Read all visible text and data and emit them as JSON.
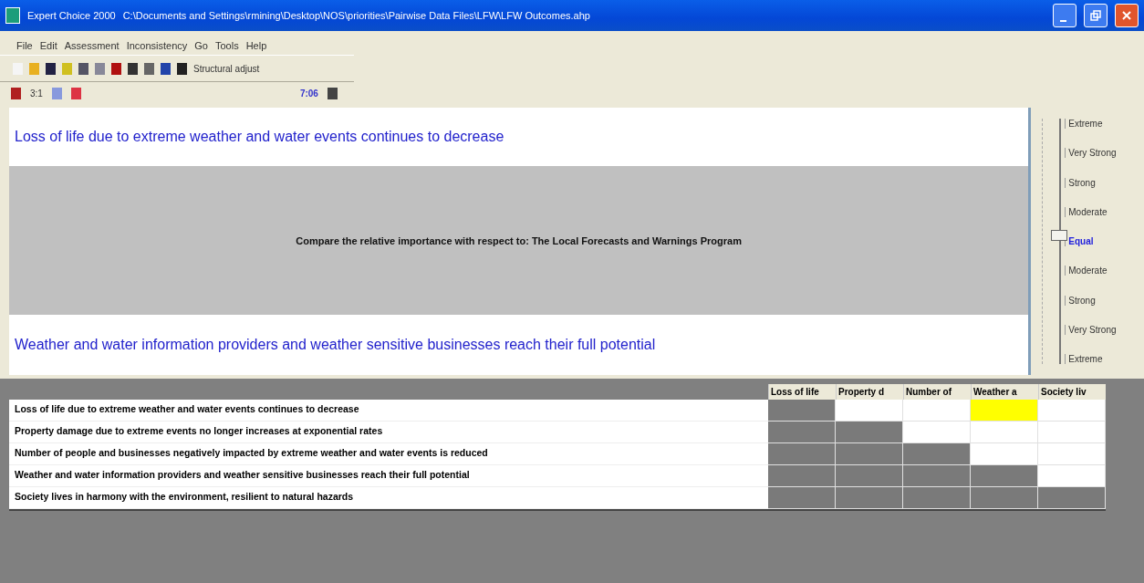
{
  "window": {
    "app": "Expert Choice 2000",
    "path": "C:\\Documents and Settings\\rmining\\Desktop\\NOS\\priorities\\Pairwise Data Files\\LFW\\LFW Outcomes.ahp"
  },
  "menu": [
    "File",
    "Edit",
    "Assessment",
    "Inconsistency",
    "Go",
    "Tools",
    "Help"
  ],
  "toolbar": {
    "structural_label": "Structural adjust",
    "ratio": "3:1",
    "counter": "7:06"
  },
  "comparison": {
    "top": "Loss of life due to extreme weather and water events continues to decrease",
    "prompt": "Compare the relative importance  with respect to: The Local Forecasts and Warnings Program",
    "bottom": "Weather and water information providers and weather sensitive businesses reach their full potential"
  },
  "scale": [
    {
      "label": "Extreme",
      "selected": false
    },
    {
      "label": "Very Strong",
      "selected": false
    },
    {
      "label": "Strong",
      "selected": false
    },
    {
      "label": "Moderate",
      "selected": false
    },
    {
      "label": "Equal",
      "selected": true
    },
    {
      "label": "Moderate",
      "selected": false
    },
    {
      "label": "Strong",
      "selected": false
    },
    {
      "label": "Very Strong",
      "selected": false
    },
    {
      "label": "Extreme",
      "selected": false
    }
  ],
  "matrix": {
    "columns": [
      "Loss of life",
      "Property d",
      "Number of",
      "Weather a",
      "Society liv"
    ],
    "rows": [
      {
        "label": "Loss of life due to extreme weather and water events continues to decrease",
        "cells": [
          {
            "shaded": true,
            "selected": false
          },
          {
            "shaded": false,
            "selected": false
          },
          {
            "shaded": false,
            "selected": false
          },
          {
            "shaded": false,
            "selected": true
          },
          {
            "shaded": false,
            "selected": false
          }
        ]
      },
      {
        "label": "Property damage due to extreme events no longer increases at exponential rates",
        "cells": [
          {
            "shaded": true,
            "selected": false
          },
          {
            "shaded": true,
            "selected": false
          },
          {
            "shaded": false,
            "selected": false
          },
          {
            "shaded": false,
            "selected": false
          },
          {
            "shaded": false,
            "selected": false
          }
        ]
      },
      {
        "label": "Number of people and businesses negatively impacted by extreme weather and water events is reduced",
        "cells": [
          {
            "shaded": true,
            "selected": false
          },
          {
            "shaded": true,
            "selected": false
          },
          {
            "shaded": true,
            "selected": false
          },
          {
            "shaded": false,
            "selected": false
          },
          {
            "shaded": false,
            "selected": false
          }
        ]
      },
      {
        "label": "Weather and water information providers and weather sensitive businesses reach their full potential",
        "cells": [
          {
            "shaded": true,
            "selected": false
          },
          {
            "shaded": true,
            "selected": false
          },
          {
            "shaded": true,
            "selected": false
          },
          {
            "shaded": true,
            "selected": false
          },
          {
            "shaded": false,
            "selected": false
          }
        ]
      },
      {
        "label": "Society lives in harmony with the environment, resilient to natural hazards",
        "cells": [
          {
            "shaded": true,
            "selected": false
          },
          {
            "shaded": true,
            "selected": false
          },
          {
            "shaded": true,
            "selected": false
          },
          {
            "shaded": true,
            "selected": false
          },
          {
            "shaded": true,
            "selected": false
          }
        ]
      }
    ]
  }
}
